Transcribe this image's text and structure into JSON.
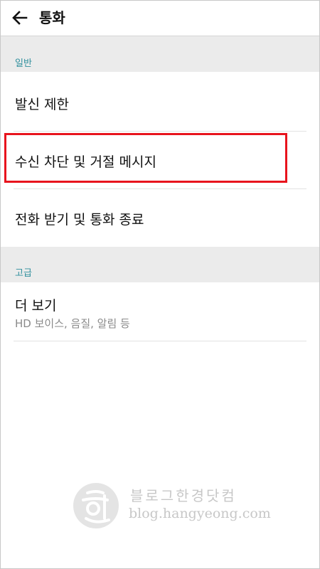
{
  "header": {
    "title": "통화",
    "back_icon": "arrow-left-icon"
  },
  "sections": {
    "general": {
      "label": "일반",
      "items": [
        {
          "label": "발신 제한"
        },
        {
          "label": "수신 차단 및 거절 메시지",
          "highlighted": true
        },
        {
          "label": "전화 받기 및 통화 종료"
        }
      ]
    },
    "advanced": {
      "label": "고급",
      "items": [
        {
          "label": "더 보기",
          "sublabel": "HD 보이스, 음질, 알림 등"
        }
      ]
    }
  },
  "watermark": {
    "title": "블로그한경닷컴",
    "url": "blog.hangyeong.com"
  },
  "colors": {
    "section_header_text": "#2f8f9d",
    "section_header_bg": "#ebebeb",
    "highlight_border": "#e8141d",
    "secondary_text": "#8a8a8a"
  }
}
